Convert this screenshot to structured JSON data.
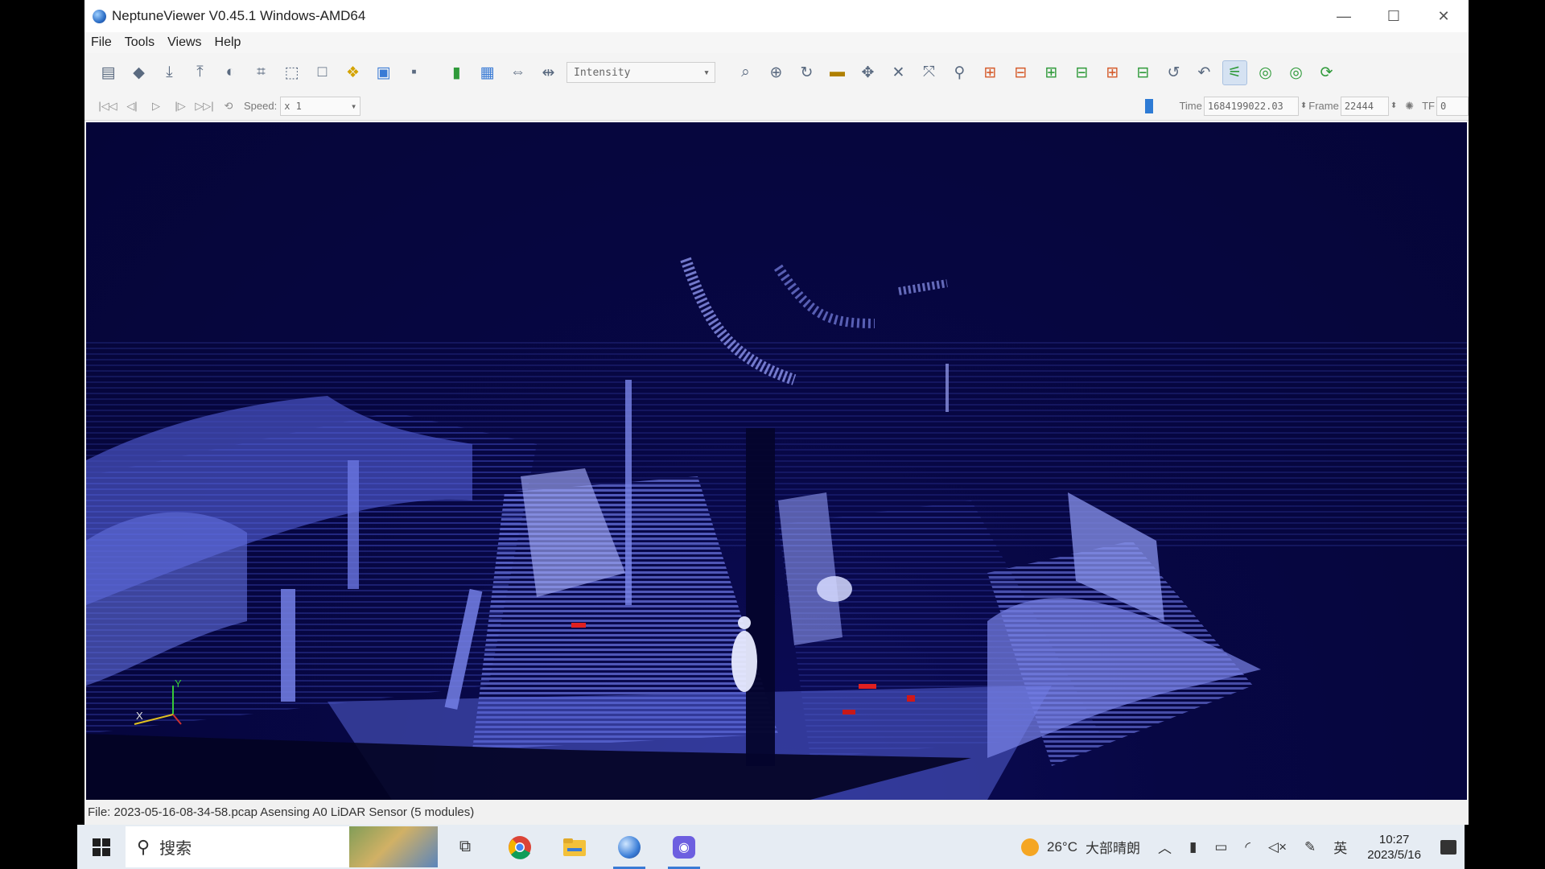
{
  "window": {
    "title": "NeptuneViewer V0.45.1 Windows-AMD64",
    "minimize": "—",
    "maximize": "☐",
    "close": "✕"
  },
  "menu": [
    "File",
    "Tools",
    "Views",
    "Help"
  ],
  "toolbar": {
    "color_by": "Intensity"
  },
  "playback": {
    "speed_label": "Speed:",
    "speed_value": "x 1",
    "time_label": "Time",
    "time_value": "1684199022.03",
    "frame_label": "Frame",
    "frame_value": "22444",
    "tf_label": "TF",
    "tf_value": "0"
  },
  "axes": {
    "x": "X",
    "y": "Y"
  },
  "statusbar": {
    "text": "File: 2023-05-16-08-34-58.pcap Asensing A0 LiDAR Sensor (5 modules)"
  },
  "taskbar": {
    "search_placeholder": "搜索",
    "weather_temp": "26°C",
    "weather_desc": "大部晴朗",
    "ime": "英",
    "time": "10:27",
    "date": "2023/5/16"
  },
  "colors": {
    "viewport_bg": "#07074a",
    "points": "#5b66d6",
    "accent": "#3a7bd5"
  }
}
